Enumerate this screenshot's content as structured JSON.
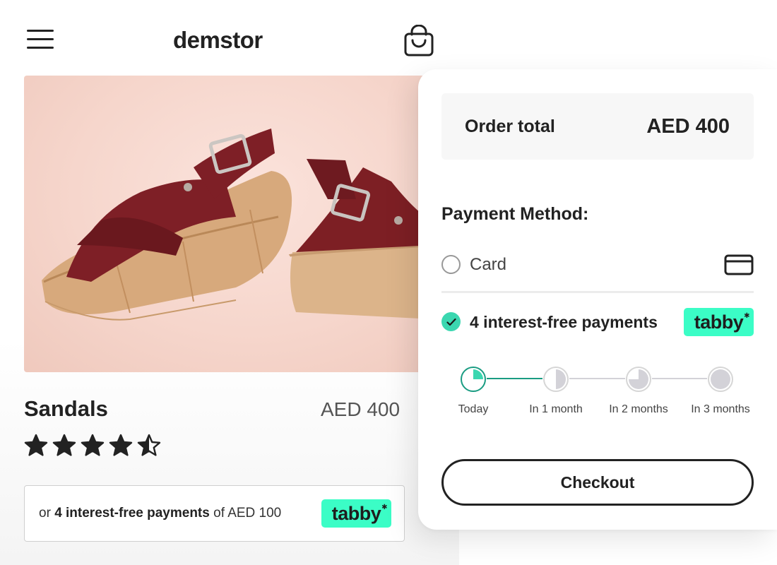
{
  "header": {
    "store_name": "demstor",
    "menu_icon": "hamburger-menu-icon",
    "cart_icon": "shopping-bag-icon"
  },
  "product": {
    "name": "Sandals",
    "price": "AED 400",
    "image": "red-platform-sandals-photo",
    "rating": 4.5,
    "rating_max": 5
  },
  "promo": {
    "prefix": "or ",
    "highlight": "4 interest-free payments",
    "suffix": " of AED 100",
    "badge": "tabby"
  },
  "checkout": {
    "order_total_label": "Order total",
    "order_total_value": "AED 400",
    "payment_method_title": "Payment Method:",
    "options": [
      {
        "label": "Card",
        "selected": false,
        "icon": "credit-card-icon"
      },
      {
        "label": "4 interest-free payments",
        "selected": true,
        "badge": "tabby"
      }
    ],
    "schedule": [
      {
        "label": "Today",
        "fraction": 0.25
      },
      {
        "label": "In 1 month",
        "fraction": 0.5
      },
      {
        "label": "In 2 months",
        "fraction": 0.75
      },
      {
        "label": "In 3 months",
        "fraction": 1.0
      }
    ],
    "button_label": "Checkout"
  },
  "colors": {
    "accent": "#3bfdc6",
    "accent_dark": "#1a9c82",
    "text": "#222222",
    "muted": "#d3d2d8"
  }
}
